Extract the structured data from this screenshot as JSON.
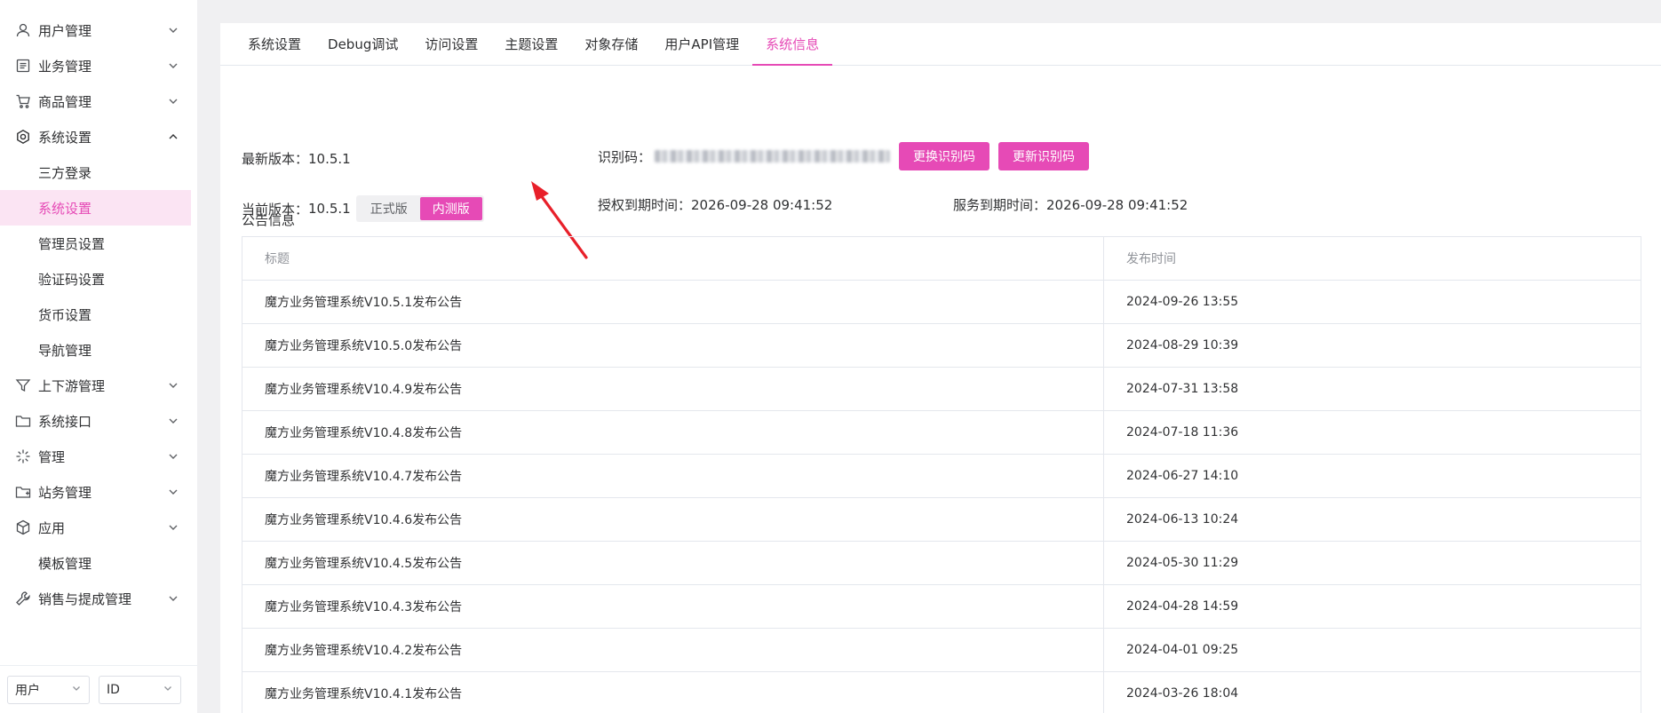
{
  "sidebar": {
    "menu": [
      {
        "label": "用户管理",
        "icon": "user-icon",
        "expanded": false
      },
      {
        "label": "业务管理",
        "icon": "document-icon",
        "expanded": false
      },
      {
        "label": "商品管理",
        "icon": "cart-icon",
        "expanded": false
      },
      {
        "label": "系统设置",
        "icon": "gear-icon",
        "expanded": true
      },
      {
        "label": "上下游管理",
        "icon": "filter-icon",
        "expanded": false
      },
      {
        "label": "系统接口",
        "icon": "folder-icon",
        "expanded": false
      },
      {
        "label": "管理",
        "icon": "sparkle-icon",
        "expanded": false
      },
      {
        "label": "站务管理",
        "icon": "folder-plus-icon",
        "expanded": false
      },
      {
        "label": "应用",
        "icon": "cube-icon",
        "expanded": false
      },
      {
        "label": "销售与提成管理",
        "icon": "wrench-icon",
        "expanded": false
      }
    ],
    "settings_sub": [
      "三方登录",
      "系统设置",
      "管理员设置",
      "验证码设置",
      "货币设置",
      "导航管理"
    ],
    "app_sub": [
      "模板管理"
    ],
    "bottom": {
      "select1": "用户",
      "select2": "ID"
    }
  },
  "tabs": [
    "系统设置",
    "Debug调试",
    "访问设置",
    "主题设置",
    "对象存储",
    "用户API管理",
    "系统信息"
  ],
  "active_tab": "系统信息",
  "info": {
    "latest_label": "最新版本：",
    "latest_value": "10.5.1",
    "current_label": "当前版本：",
    "current_value": "10.5.1",
    "toggle_off": "正式版",
    "toggle_on": "内测版",
    "code_label": "识别码：",
    "btn_change": "更换识别码",
    "btn_update": "更新识别码",
    "auth_label": "授权到期时间：",
    "auth_value": "2026-09-28 09:41:52",
    "service_label": "服务到期时间：",
    "service_value": "2026-09-28 09:41:52"
  },
  "notice": {
    "title": "公告信息",
    "headers": [
      "标题",
      "发布时间"
    ],
    "rows": [
      {
        "title": "魔方业务管理系统V10.5.1发布公告",
        "time": "2024-09-26 13:55"
      },
      {
        "title": "魔方业务管理系统V10.5.0发布公告",
        "time": "2024-08-29 10:39"
      },
      {
        "title": "魔方业务管理系统V10.4.9发布公告",
        "time": "2024-07-31 13:58"
      },
      {
        "title": "魔方业务管理系统V10.4.8发布公告",
        "time": "2024-07-18 11:36"
      },
      {
        "title": "魔方业务管理系统V10.4.7发布公告",
        "time": "2024-06-27 14:10"
      },
      {
        "title": "魔方业务管理系统V10.4.6发布公告",
        "time": "2024-06-13 10:24"
      },
      {
        "title": "魔方业务管理系统V10.4.5发布公告",
        "time": "2024-05-30 11:29"
      },
      {
        "title": "魔方业务管理系统V10.4.3发布公告",
        "time": "2024-04-28 14:59"
      },
      {
        "title": "魔方业务管理系统V10.4.2发布公告",
        "time": "2024-04-01 09:25"
      },
      {
        "title": "魔方业务管理系统V10.4.1发布公告",
        "time": "2024-03-26 18:04"
      }
    ]
  },
  "colors": {
    "accent": "#e64ab6",
    "accent_light": "#fbe4f3",
    "arrow": "#e8202a"
  }
}
